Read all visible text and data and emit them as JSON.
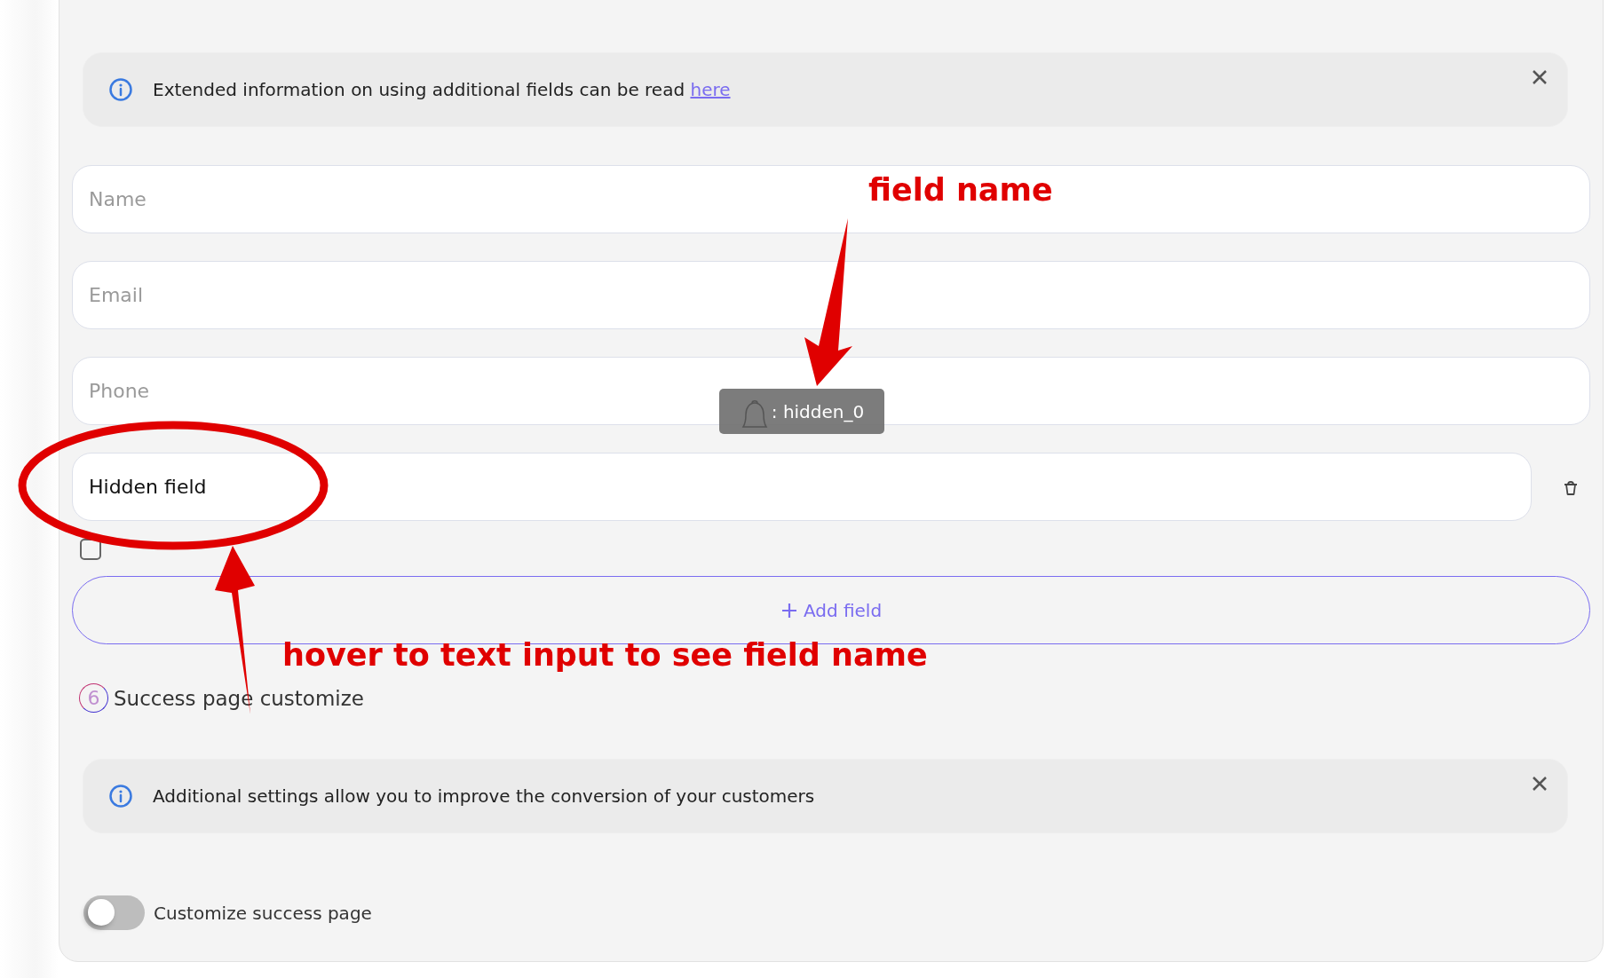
{
  "info_banners": [
    {
      "text": "Extended information on using additional fields can be read ",
      "link": "here"
    },
    {
      "text": "Additional settings allow you to improve the conversion of your customers"
    }
  ],
  "fields": [
    {
      "placeholder": "Name",
      "deletable": false
    },
    {
      "placeholder": "Email",
      "deletable": false
    },
    {
      "placeholder": "Phone",
      "deletable": false
    },
    {
      "value": "Hidden field",
      "deletable": true
    }
  ],
  "tooltip": {
    "text": ": hidden_0"
  },
  "required": {
    "checked": false
  },
  "add_field": {
    "label": "Add field"
  },
  "step": {
    "number": "6",
    "title": "Success page customize"
  },
  "toggle": {
    "label": "Customize success page",
    "on": false
  },
  "annotations": [
    {
      "kind": "top",
      "text": "field name"
    },
    {
      "kind": "bottom",
      "text": "hover to text input to see field name"
    }
  ]
}
